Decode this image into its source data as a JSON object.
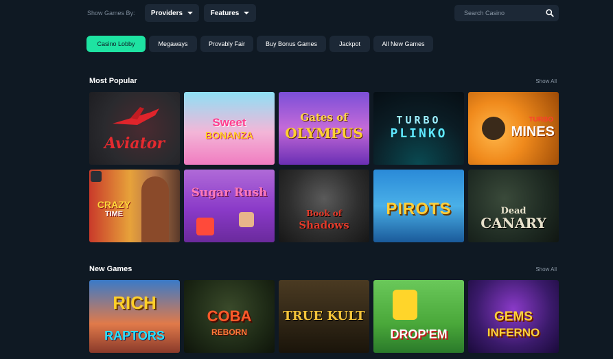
{
  "filters": {
    "show_by_label": "Show Games By:",
    "providers_label": "Providers",
    "features_label": "Features",
    "search_placeholder": "Search Casino"
  },
  "categories": [
    {
      "label": "Casino Lobby",
      "active": true
    },
    {
      "label": "Megaways",
      "active": false
    },
    {
      "label": "Provably Fair",
      "active": false
    },
    {
      "label": "Buy Bonus Games",
      "active": false
    },
    {
      "label": "Jackpot",
      "active": false
    },
    {
      "label": "All New Games",
      "active": false
    }
  ],
  "sections": {
    "popular": {
      "title": "Most Popular",
      "show_all": "Show All",
      "games": [
        {
          "line1": "Aviator",
          "line2": ""
        },
        {
          "line1": "Sweet",
          "line2": "BONANZA"
        },
        {
          "line1": "Gates of",
          "line2": "OLYMPUS"
        },
        {
          "line1": "TURBO",
          "line2": "PLINKO"
        },
        {
          "line1": "TURBO",
          "line2": "MINES"
        },
        {
          "line1": "CRAZY",
          "line2": "TIME"
        },
        {
          "line1": "Sugar Rush",
          "line2": ""
        },
        {
          "line1": "Book of",
          "line2": "Shadows"
        },
        {
          "line1": "PIROTS",
          "line2": ""
        },
        {
          "line1": "Dead",
          "line2": "CANARY"
        }
      ]
    },
    "new": {
      "title": "New Games",
      "show_all": "Show All",
      "games": [
        {
          "line1": "RICH",
          "line2": "RAPTORS"
        },
        {
          "line1": "COBA",
          "line2": "REBORN"
        },
        {
          "line1": "TRUE KULT",
          "line2": ""
        },
        {
          "line1": "DROP'EM",
          "line2": ""
        },
        {
          "line1": "GEMS",
          "line2": "INFERNO"
        }
      ]
    }
  },
  "colors": {
    "background": "#0f1923",
    "surface": "#1c2836",
    "accent": "#1ee3a2",
    "muted_text": "#8b98a6"
  },
  "icons": {
    "search": "search-icon",
    "dropdown": "chevron-down-icon"
  }
}
